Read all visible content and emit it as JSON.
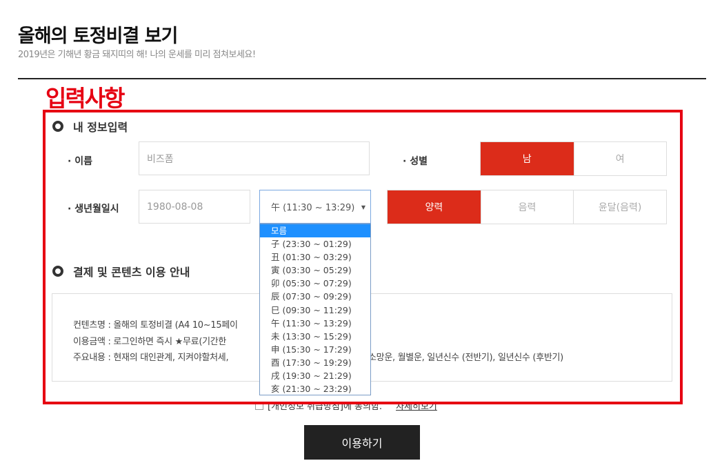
{
  "page": {
    "title": "올해의 토정비결 보기",
    "subtitle": "2019년은 기해년 황금 돼지띠의 해! 나의 운세를 미리 점쳐보세요!"
  },
  "annotation": {
    "label": "입력사항",
    "color": "#e60012"
  },
  "my_info": {
    "section_title": "내 정보입력",
    "name_label": "· 이름",
    "name_value": "비즈폼",
    "gender_label": "· 성별",
    "gender_options": [
      "남",
      "여"
    ],
    "gender_selected": "남",
    "birth_label": "· 생년월일시",
    "birth_value": "1980-08-08",
    "time_selected": "午 (11:30 ~ 13:29)",
    "time_options": [
      "모름",
      "子 (23:30 ~ 01:29)",
      "丑 (01:30 ~ 03:29)",
      "寅 (03:30 ~ 05:29)",
      "卯 (05:30 ~ 07:29)",
      "辰 (07:30 ~ 09:29)",
      "巳 (09:30 ~ 11:29)",
      "午 (11:30 ~ 13:29)",
      "未 (13:30 ~ 15:29)",
      "申 (15:30 ~ 17:29)",
      "酉 (17:30 ~ 19:29)",
      "戌 (19:30 ~ 21:29)",
      "亥 (21:30 ~ 23:29)"
    ],
    "time_highlighted": "모름",
    "calendar_options": [
      "양력",
      "음력",
      "윤달(음력)"
    ],
    "calendar_selected": "양력"
  },
  "payment": {
    "section_title": "결제 및 콘텐츠 이용 안내",
    "line_1": "컨텐츠명 : 올해의 토정비결 (A4 10~15페이",
    "line_2": "이용금액 : 로그인하면 즉시 ★무료(기간한",
    "line_3": "주요내용 : 현재의 대인관계, 지켜야할처세,",
    "line_3_tail": "소망운, 월별운, 일년신수 (전반기), 일년신수 (후반기)"
  },
  "agreement": {
    "text": "[개인정보 취급방침]에 동의함.",
    "link": "자세히보기"
  },
  "submit": {
    "label": "이용하기"
  },
  "colors": {
    "accent": "#dc2c1a",
    "dropdown_highlight": "#1e90ff",
    "button_dark": "#222222"
  }
}
